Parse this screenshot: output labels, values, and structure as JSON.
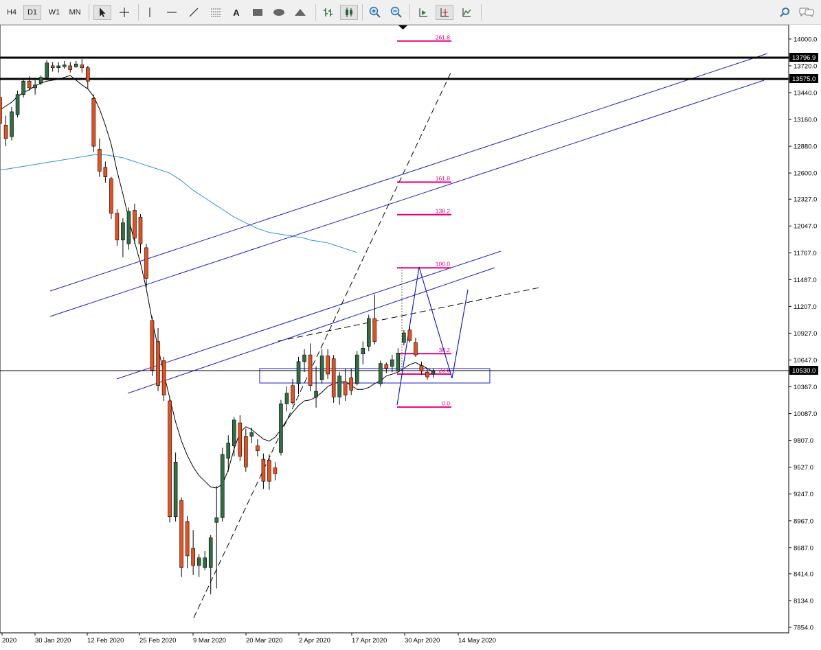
{
  "toolbar": {
    "timeframes": [
      "H4",
      "D1",
      "W1",
      "MN"
    ],
    "selected_timeframe": "D1"
  },
  "chart_data": {
    "type": "candlestick",
    "instrument_note": "",
    "price_axis": {
      "ticks": [
        "14000.0",
        "13720.0",
        "13440.0",
        "13160.0",
        "12880.0",
        "12600.0",
        "12327.0",
        "12047.0",
        "11767.0",
        "11487.0",
        "11207.0",
        "10927.0",
        "10647.0",
        "10367.0",
        "10087.0",
        "9807.0",
        "9527.0",
        "9247.0",
        "8967.0",
        "8687.0",
        "8414.0",
        "8134.0",
        "7854.0"
      ],
      "ylim": [
        7854,
        14000
      ],
      "labels": {
        "upper_level": "13796.9",
        "lower_level": "13575.0",
        "current_price": "10530.0"
      }
    },
    "time_axis": {
      "ticks": [
        "2020",
        "30 Jan 2020",
        "12 Feb 2020",
        "25 Feb 2020",
        "9 Mar 2020",
        "20 Mar 2020",
        "2 Apr 2020",
        "17 Apr 2020",
        "30 Apr 2020",
        "14 May 2020"
      ]
    },
    "candles": [
      {
        "o": 13390,
        "h": 13440,
        "l": 13040,
        "c": 13120
      },
      {
        "o": 13100,
        "h": 13200,
        "l": 12880,
        "c": 12960
      },
      {
        "o": 12980,
        "h": 13290,
        "l": 12940,
        "c": 13240
      },
      {
        "o": 13210,
        "h": 13460,
        "l": 13180,
        "c": 13420
      },
      {
        "o": 13420,
        "h": 13590,
        "l": 13390,
        "c": 13560
      },
      {
        "o": 13560,
        "h": 13610,
        "l": 13460,
        "c": 13490
      },
      {
        "o": 13490,
        "h": 13570,
        "l": 13420,
        "c": 13520
      },
      {
        "o": 13540,
        "h": 13620,
        "l": 13520,
        "c": 13600
      },
      {
        "o": 13600,
        "h": 13780,
        "l": 13570,
        "c": 13750
      },
      {
        "o": 13720,
        "h": 13760,
        "l": 13660,
        "c": 13700
      },
      {
        "o": 13700,
        "h": 13760,
        "l": 13650,
        "c": 13720
      },
      {
        "o": 13710,
        "h": 13770,
        "l": 13690,
        "c": 13730
      },
      {
        "o": 13720,
        "h": 13760,
        "l": 13650,
        "c": 13680
      },
      {
        "o": 13710,
        "h": 13770,
        "l": 13700,
        "c": 13740
      },
      {
        "o": 13730,
        "h": 13790,
        "l": 13650,
        "c": 13700
      },
      {
        "o": 13700,
        "h": 13720,
        "l": 13480,
        "c": 13560
      },
      {
        "o": 13380,
        "h": 13420,
        "l": 12820,
        "c": 12880
      },
      {
        "o": 12850,
        "h": 12960,
        "l": 12560,
        "c": 12620
      },
      {
        "o": 12660,
        "h": 12720,
        "l": 12500,
        "c": 12560
      },
      {
        "o": 12540,
        "h": 12560,
        "l": 12120,
        "c": 12180
      },
      {
        "o": 12180,
        "h": 12220,
        "l": 11840,
        "c": 11900
      },
      {
        "o": 11900,
        "h": 12130,
        "l": 11720,
        "c": 12080
      },
      {
        "o": 11860,
        "h": 12240,
        "l": 11800,
        "c": 12200
      },
      {
        "o": 12210,
        "h": 12280,
        "l": 11860,
        "c": 11920
      },
      {
        "o": 12140,
        "h": 12170,
        "l": 11760,
        "c": 11860
      },
      {
        "o": 11820,
        "h": 11860,
        "l": 11400,
        "c": 11500
      },
      {
        "o": 11060,
        "h": 11100,
        "l": 10480,
        "c": 10540
      },
      {
        "o": 10840,
        "h": 10980,
        "l": 10320,
        "c": 10380
      },
      {
        "o": 10640,
        "h": 10680,
        "l": 10220,
        "c": 10280
      },
      {
        "o": 10220,
        "h": 10260,
        "l": 8950,
        "c": 9010
      },
      {
        "o": 9010,
        "h": 9680,
        "l": 8960,
        "c": 9580
      },
      {
        "o": 9180,
        "h": 9210,
        "l": 8380,
        "c": 8480
      },
      {
        "o": 8960,
        "h": 9020,
        "l": 8470,
        "c": 8600
      },
      {
        "o": 8680,
        "h": 8870,
        "l": 8400,
        "c": 8500
      },
      {
        "o": 8500,
        "h": 8620,
        "l": 8380,
        "c": 8580
      },
      {
        "o": 8480,
        "h": 8650,
        "l": 8450,
        "c": 8580
      },
      {
        "o": 8480,
        "h": 8820,
        "l": 8200,
        "c": 8790
      },
      {
        "o": 8950,
        "h": 9330,
        "l": 8260,
        "c": 9000
      },
      {
        "o": 9000,
        "h": 9730,
        "l": 8960,
        "c": 9660
      },
      {
        "o": 9620,
        "h": 9860,
        "l": 9480,
        "c": 9780
      },
      {
        "o": 9750,
        "h": 10050,
        "l": 9640,
        "c": 10020
      },
      {
        "o": 9990,
        "h": 10070,
        "l": 9590,
        "c": 9640
      },
      {
        "o": 9850,
        "h": 9930,
        "l": 9480,
        "c": 9530
      },
      {
        "o": 9850,
        "h": 9940,
        "l": 9780,
        "c": 9890
      },
      {
        "o": 9750,
        "h": 9820,
        "l": 9640,
        "c": 9700
      },
      {
        "o": 9610,
        "h": 9670,
        "l": 9300,
        "c": 9380
      },
      {
        "o": 9600,
        "h": 9660,
        "l": 9290,
        "c": 9380
      },
      {
        "o": 9520,
        "h": 9580,
        "l": 9390,
        "c": 9460
      },
      {
        "o": 9680,
        "h": 10230,
        "l": 9650,
        "c": 10190
      },
      {
        "o": 10190,
        "h": 10370,
        "l": 10110,
        "c": 10300
      },
      {
        "o": 10380,
        "h": 10450,
        "l": 10180,
        "c": 10200
      },
      {
        "o": 10400,
        "h": 10680,
        "l": 10290,
        "c": 10630
      },
      {
        "o": 10630,
        "h": 10760,
        "l": 10520,
        "c": 10700
      },
      {
        "o": 10700,
        "h": 10820,
        "l": 10320,
        "c": 10380
      },
      {
        "o": 10260,
        "h": 10580,
        "l": 10150,
        "c": 10320
      },
      {
        "o": 10440,
        "h": 10760,
        "l": 10400,
        "c": 10690
      },
      {
        "o": 10690,
        "h": 10760,
        "l": 10450,
        "c": 10500
      },
      {
        "o": 10660,
        "h": 10700,
        "l": 10200,
        "c": 10260
      },
      {
        "o": 10260,
        "h": 10520,
        "l": 10180,
        "c": 10480
      },
      {
        "o": 10420,
        "h": 10560,
        "l": 10220,
        "c": 10280
      },
      {
        "o": 10460,
        "h": 10560,
        "l": 10280,
        "c": 10330
      },
      {
        "o": 10400,
        "h": 10740,
        "l": 10380,
        "c": 10700
      },
      {
        "o": 10710,
        "h": 10840,
        "l": 10600,
        "c": 10770
      },
      {
        "o": 10790,
        "h": 11120,
        "l": 10740,
        "c": 11080
      },
      {
        "o": 11080,
        "h": 11330,
        "l": 10810,
        "c": 10840
      },
      {
        "o": 10400,
        "h": 10640,
        "l": 10370,
        "c": 10610
      },
      {
        "o": 10600,
        "h": 10620,
        "l": 10510,
        "c": 10560
      },
      {
        "o": 10580,
        "h": 10700,
        "l": 10520,
        "c": 10650
      },
      {
        "o": 10530,
        "h": 10770,
        "l": 10520,
        "c": 10720
      },
      {
        "o": 10830,
        "h": 10960,
        "l": 10800,
        "c": 10930
      },
      {
        "o": 10960,
        "h": 11010,
        "l": 10830,
        "c": 10850
      },
      {
        "o": 10830,
        "h": 10880,
        "l": 10680,
        "c": 10700
      },
      {
        "o": 10590,
        "h": 10630,
        "l": 10490,
        "c": 10530
      },
      {
        "o": 10520,
        "h": 10560,
        "l": 10440,
        "c": 10470
      },
      {
        "o": 10500,
        "h": 10560,
        "l": 10460,
        "c": 10530
      }
    ],
    "ma_fast": [
      13260,
      13300,
      13340,
      13400,
      13440,
      13470,
      13510,
      13540,
      13560,
      13570,
      13580,
      13600,
      13620,
      13570,
      13520,
      13480,
      13400,
      13270,
      13100,
      12900,
      12620,
      12380,
      12120,
      11880,
      11660,
      11390,
      11060,
      10780,
      10500,
      10250,
      10000,
      9800,
      9650,
      9530,
      9440,
      9380,
      9320,
      9310,
      9350,
      9500,
      9720,
      9890,
      9950,
      9920,
      9870,
      9820,
      9800,
      9840,
      9920,
      10020,
      10100,
      10170,
      10220,
      10230,
      10260,
      10310,
      10370,
      10400,
      10420,
      10420,
      10380,
      10340,
      10340,
      10360,
      10400,
      10430,
      10480,
      10500,
      10520,
      10560,
      10600,
      10620,
      10590,
      10560,
      10520
    ],
    "ma_slow_from_index": 0,
    "ma_slow": [
      12630,
      12640,
      12650,
      12660,
      12670,
      12680,
      12690,
      12700,
      12710,
      12720,
      12730,
      12740,
      12750,
      12760,
      12770,
      12780,
      12790,
      12790,
      12790,
      12780,
      12770,
      12760,
      12740,
      12720,
      12700,
      12680,
      12660,
      12640,
      12620,
      12600,
      12560,
      12520,
      12470,
      12420,
      12380,
      12340,
      12300,
      12260,
      12220,
      12180,
      12140,
      12110,
      12080,
      12050,
      12020,
      12000,
      11980,
      11970,
      11960,
      11950,
      11940,
      11930,
      11920,
      11900,
      11890,
      11880,
      11870,
      11850,
      11830,
      11810,
      11790,
      11770
    ],
    "horizontal_levels": [
      13796.9,
      13575.0,
      10530.0
    ],
    "fibonacci": {
      "levels": [
        {
          "label": "261.8",
          "price": 13979
        },
        {
          "label": "161.8",
          "price": 12505
        },
        {
          "label": "138.2",
          "price": 12165
        },
        {
          "label": "100.0",
          "price": 11610
        },
        {
          "label": "38.2",
          "price": 10713
        },
        {
          "label": "23.6",
          "price": 10500
        },
        {
          "label": "0.0",
          "price": 10155
        }
      ]
    }
  },
  "colors": {
    "bull": "#2f6f43",
    "bear": "#ea4f1e",
    "trendline_blue": "#1b1bcb",
    "fib": "#e6007e",
    "ma_slow": "#2d8fe0",
    "ma_fast": "#000000",
    "label_bg": "#000000"
  }
}
